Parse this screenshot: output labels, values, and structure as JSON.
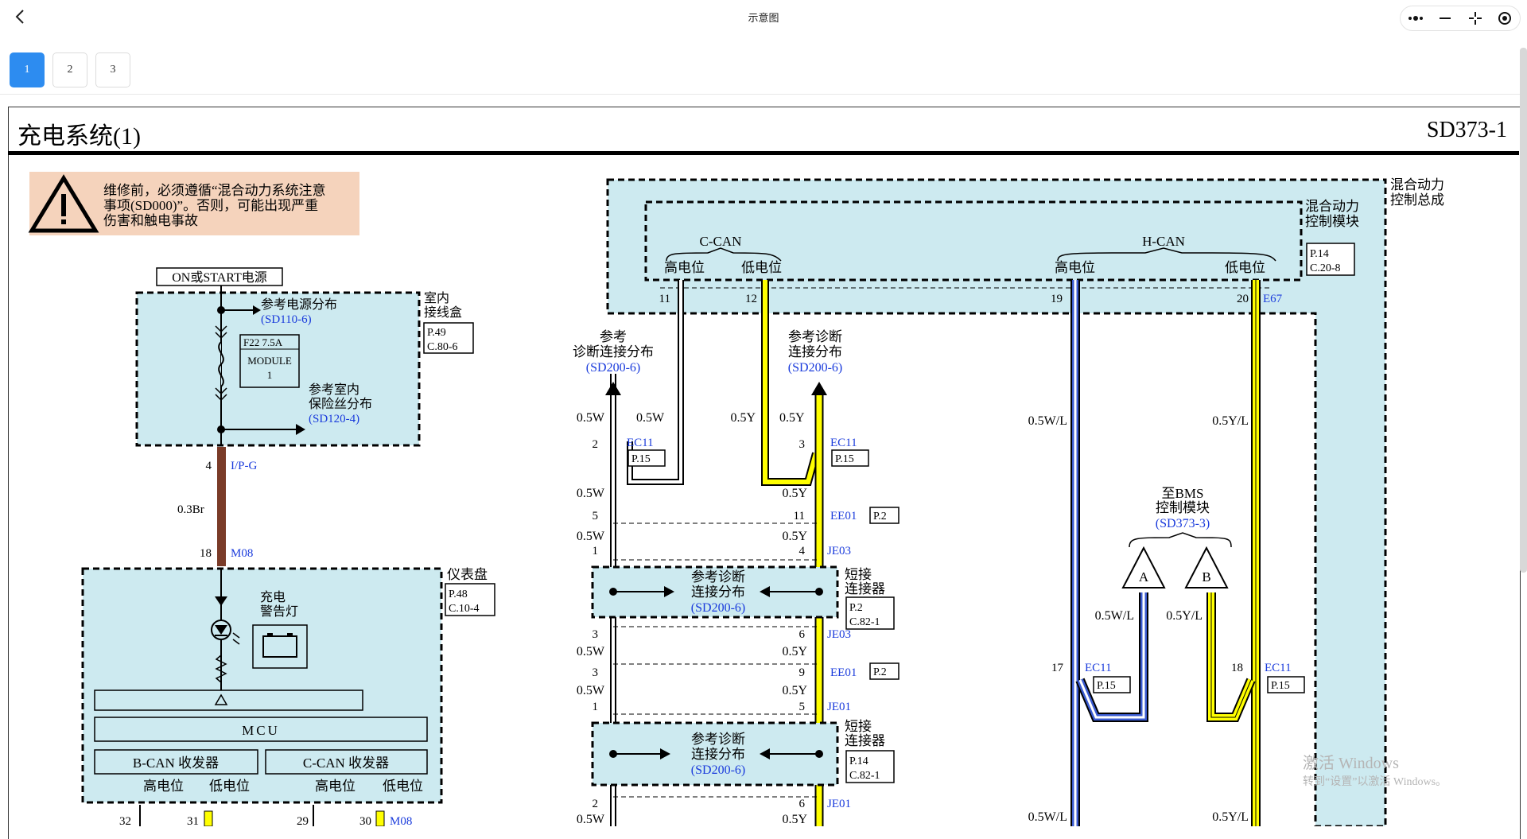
{
  "window": {
    "title": "示意图"
  },
  "pages": [
    "1",
    "2",
    "3"
  ],
  "doc": {
    "title": "充电系统(1)",
    "code": "SD373-1"
  },
  "warning": {
    "line1": "维修前，必须遵循“混合动力系统注意",
    "line2": "事项(SD000)”。否则，可能出现严重",
    "line3": "伤害和触电事故"
  },
  "power": {
    "source": "ON或START电源",
    "ref_power_l1": "参考电源分布",
    "ref_power_l2": "(SD110-6)",
    "fuse_l1": "F22 7.5A",
    "fuse_l2": "MODULE",
    "fuse_l3": "1",
    "ref_fuse_l1": "参考室内",
    "ref_fuse_l2": "保险丝分布",
    "ref_fuse_l3": "(SD120-4)",
    "box_l1": "室内",
    "box_l2": "接线盒",
    "box_ref_l1": "P.49",
    "box_ref_l2": "C.80-6"
  },
  "left_wire": {
    "pin_top": "4",
    "conn_top": "I/P-G",
    "wire": "0.3Br",
    "pin_bottom": "18",
    "conn_bottom": "M08"
  },
  "cluster": {
    "name": "仪表盘",
    "ref_l1": "P.48",
    "ref_l2": "C.10-4",
    "lamp_l1": "充电",
    "lamp_l2": "警告灯",
    "mcu": "MCU",
    "bcan": "B-CAN 收发器",
    "ccan": "C-CAN 收发器",
    "high": "高电位",
    "low": "低电位",
    "pins": [
      "32",
      "31",
      "29",
      "30"
    ],
    "conn": "M08"
  },
  "hcu": {
    "outer_l1": "混合动力",
    "outer_l2": "控制总成",
    "inner_l1": "混合动力",
    "inner_l2": "控制模块",
    "ref_l1": "P.14",
    "ref_l2": "C.20-8",
    "ccan": "C-CAN",
    "hcan": "H-CAN",
    "high": "高电位",
    "low": "低电位",
    "pins": [
      "11",
      "12",
      "19",
      "20"
    ],
    "conn": "E67"
  },
  "diag": {
    "ref_left_l1": "参考",
    "ref_left_l2": "诊断连接分布",
    "ref_left_l3": "(SD200-6)",
    "ref_right_l1": "参考诊断",
    "ref_right_l2": "连接分布",
    "ref_right_l3": "(SD200-6)",
    "wire_w": "0.5W",
    "wire_y": "0.5Y",
    "ec11": "EC11",
    "p15": "P.15",
    "ee01": "EE01",
    "p2": "P.2",
    "je03": "JE03",
    "je01": "JE01",
    "pins_l": [
      "2",
      "5",
      "1",
      "3",
      "3",
      "1",
      "2"
    ],
    "pins_r": [
      "3",
      "11",
      "4",
      "6",
      "9",
      "5",
      "6"
    ],
    "join_l1": "参考诊断",
    "join_l2": "连接分布",
    "join_l3": "(SD200-6)",
    "short_l1": "短接",
    "short_l2": "连接器",
    "short1_ref_l1": "P.2",
    "short1_ref_l2": "C.82-1",
    "short2_ref_l1": "P.14",
    "short2_ref_l2": "C.82-1"
  },
  "hcan_wires": {
    "wire_wl": "0.5W/L",
    "wire_yl": "0.5Y/L",
    "bms_l1": "至BMS",
    "bms_l2": "控制模块",
    "bms_l3": "(SD373-3)",
    "tri_a": "A",
    "tri_b": "B",
    "pin17": "17",
    "pin18": "18",
    "ec11": "EC11",
    "p15": "P.15"
  },
  "watermark": {
    "l1": "激活 Windows",
    "l2": "转到“设置”以激活 Windows。"
  },
  "colors": {
    "accent": "#2d8cf0",
    "module_fill": "#cdeaf0",
    "warning_fill": "#f5d3bc",
    "wire_yellow": "#ffff00",
    "wire_brown": "#7a3b28",
    "wire_blue": "#3a5bd0",
    "link_blue": "#1a3bdc"
  },
  "icons": [
    "back-arrow-icon",
    "more-icon",
    "minimize-icon",
    "exit-icon",
    "record-icon",
    "warning-icon",
    "battery-icon"
  ]
}
